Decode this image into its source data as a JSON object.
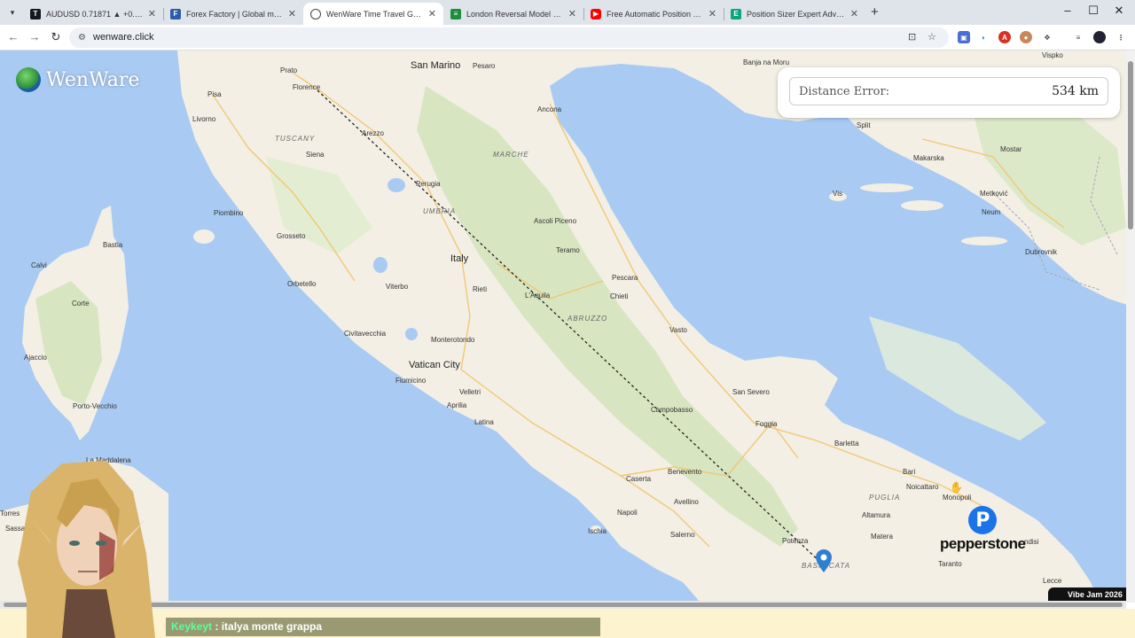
{
  "browser": {
    "tabs": [
      {
        "title": "AUDUSD 0.71871 ▲ +0.55% Au",
        "favicon": "tradingview-icon",
        "fav_color": "#131722",
        "active": false
      },
      {
        "title": "Forex Factory | Global markets f",
        "favicon": "forexfactory-icon",
        "fav_color": "#2a5fa8",
        "active": false
      },
      {
        "title": "WenWare Time Travel GeoGues",
        "favicon": "globe-icon",
        "fav_color": "#444444",
        "active": true
      },
      {
        "title": "London Reversal Model Backte",
        "favicon": "sheets-icon",
        "fav_color": "#1e8e3e",
        "active": false
      },
      {
        "title": "Free Automatic Position Lot Siz",
        "favicon": "youtube-icon",
        "fav_color": "#ff0000",
        "active": false
      },
      {
        "title": "Position Sizer Expert Advisor fo",
        "favicon": "doc-icon",
        "fav_color": "#10a37f",
        "active": false
      }
    ],
    "url": "wenware.click"
  },
  "logo": {
    "name": "WenWare"
  },
  "result": {
    "label": "Distance Error:",
    "value": "534 km"
  },
  "map": {
    "labels": {
      "san_marino": "San Marino",
      "pesaro": "Pesaro",
      "banja_na_moru": "Banja na Moru",
      "vispko": "Vispko",
      "prato": "Prato",
      "florence": "Florence",
      "pisa": "Pisa",
      "livorno": "Livorno",
      "ancona": "Ancona",
      "tuscany": "TUSCANY",
      "arezzo": "Arezzo",
      "marche": "MARCHE",
      "siena": "Siena",
      "perugia": "Perugia",
      "umbria": "UMBRIA",
      "split": "Split",
      "makarska": "Makarska",
      "mostar": "Mostar",
      "metkovic": "Metković",
      "neum": "Neum",
      "vis": "Vis",
      "dubrovnik": "Dubrovnik",
      "piombino": "Piombino",
      "ascoli": "Ascoli Piceno",
      "bastia": "Bastia",
      "grosseto": "Grosseto",
      "teramo": "Teramo",
      "italy": "Italy",
      "calvi": "Calvi",
      "corte": "Corte",
      "orbetello": "Orbetello",
      "viterbo": "Viterbo",
      "rieti": "Rieti",
      "laquila": "L'Aquila",
      "pescara": "Pescara",
      "chieti": "Chieti",
      "abruzzo": "ABRUZZO",
      "vasto": "Vasto",
      "ajaccio": "Ajaccio",
      "civitavecchia": "Civitavecchia",
      "monterotondo": "Monterotondo",
      "vatican": "Vatican City",
      "fiumicino": "Fiumicino",
      "san_severo": "San Severo",
      "velletri": "Velletri",
      "porto_vecchio": "Porto-Vecchio",
      "aprilia": "Aprilia",
      "campobasso": "Campobasso",
      "foggia": "Foggia",
      "latina": "Latina",
      "barletta": "Barletta",
      "la_maddalena": "La Maddalena",
      "benevento": "Benevento",
      "caserta": "Caserta",
      "bari": "Bari",
      "noicattaro": "Noicattaro",
      "puglia": "PUGLIA",
      "monopoli": "Monopoli",
      "avellino": "Avellino",
      "altamura": "Altamura",
      "napoli": "Napoli",
      "torres": "Torres",
      "sassari": "Sassari",
      "ischia": "Ischia",
      "salerno": "Salerno",
      "matera": "Matera",
      "potenza": "Potenza",
      "basilicata": "BASILICATA",
      "brindisi": "ndisi",
      "taranto": "Taranto",
      "lecce": "Lecce"
    }
  },
  "sponsor": {
    "name": "pepperstone",
    "mark": "P"
  },
  "badge": {
    "text": "Vibe Jam 2026"
  },
  "chat": {
    "user": "Keykeyt",
    "separator": " : ",
    "message": "italya monte grappa"
  },
  "colors": {
    "sea": "#a9cbf3",
    "land": "#f3efe4",
    "green": "#cfe3b8",
    "chat_bg": "#9a9a72"
  }
}
